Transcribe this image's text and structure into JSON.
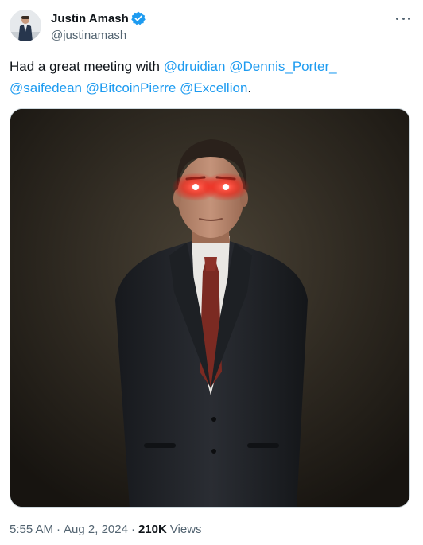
{
  "author": {
    "display_name": "Justin Amash",
    "handle": "@justinamash",
    "verified": true
  },
  "tweet": {
    "text_lead": "Had a great meeting with ",
    "mentions": [
      "@druidian",
      "@Dennis_Porter_",
      "@saifedean",
      "@BitcoinPierre",
      "@Excellion"
    ],
    "text_end": "."
  },
  "image": {
    "description": "portrait photo"
  },
  "meta": {
    "time": "5:55 AM",
    "date": "Aug 2, 2024",
    "separator": "·",
    "views_count": "210K",
    "views_label": "Views"
  },
  "colors": {
    "link": "#1d9bf0",
    "text": "#0f1419",
    "secondary": "#536471",
    "verified": "#1d9bf0"
  },
  "icons": {
    "verified": "verified-badge-icon",
    "more": "more-options-icon"
  }
}
